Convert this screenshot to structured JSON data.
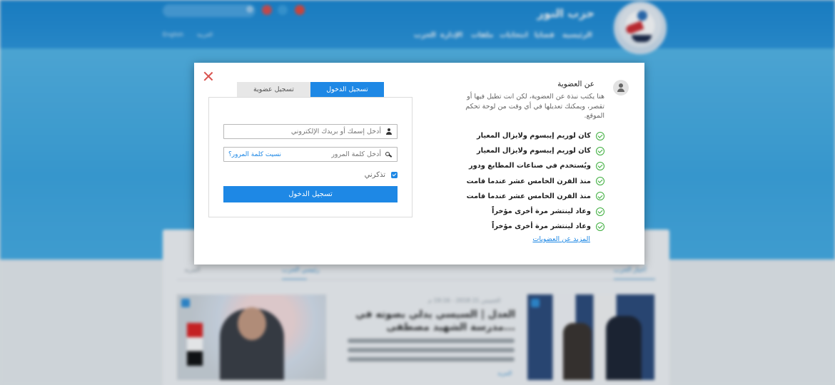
{
  "background_site": {
    "brand": "حزب النور",
    "nav_items": [
      "الرئيسية",
      "قضايا",
      "انتخابات",
      "ملفات",
      "الإدارة",
      "الحزب"
    ],
    "util_links": [
      "العربية",
      "English"
    ],
    "tabs_left": [
      "رئيسي الحزب",
      "المزيد"
    ],
    "tab_right": "أخبار الحزب",
    "article_meta": "الخميس 21 2018 - 19:16 م",
    "headline": "العدل | السيسي يدلي بصوته في مدرسة الشهيد مصطفى...",
    "read_more": "المزيد"
  },
  "modal": {
    "tabs": {
      "login": "تسجيل الدخول",
      "register": "تسجيل عضوية"
    },
    "login_form": {
      "username_placeholder": "أدخل إسمك أو بريدك الإلكتروني",
      "password_placeholder": "أدخل كلمة المرور",
      "forgot_password": "نسيت كلمة المرور؟",
      "remember_me": "تذكرني",
      "remember_checked": true,
      "submit_label": "تسجيل الدخول"
    },
    "info": {
      "title": "عن العضوية",
      "description": "هنا يكتب نبذة عن العضوية، لكن انت تطيل فيها أو تقصر، ويمكنك تعديلها في أي وقت من لوحة تحكم الموقع.",
      "features": [
        "كان لوريم إيبسوم ولايزال المعيار",
        "كان لوريم إيبسوم ولايزال المعيار",
        "ويُستخدم في صناعات المطابع ودور",
        "منذ القرن الخامس عشر عندما قامت",
        "منذ القرن الخامس عشر عندما قامت",
        "وعاد لينتشر مرة أخرى مؤخراً",
        "وعاد لينتشر مرة أخرى مؤخراً"
      ],
      "more_link": "المزيد عن العضويات"
    }
  },
  "colors": {
    "primary": "#1e88e5",
    "check_green": "#3cae3c",
    "close_red": "#d9534f",
    "header_blue": "#1a88d3"
  }
}
